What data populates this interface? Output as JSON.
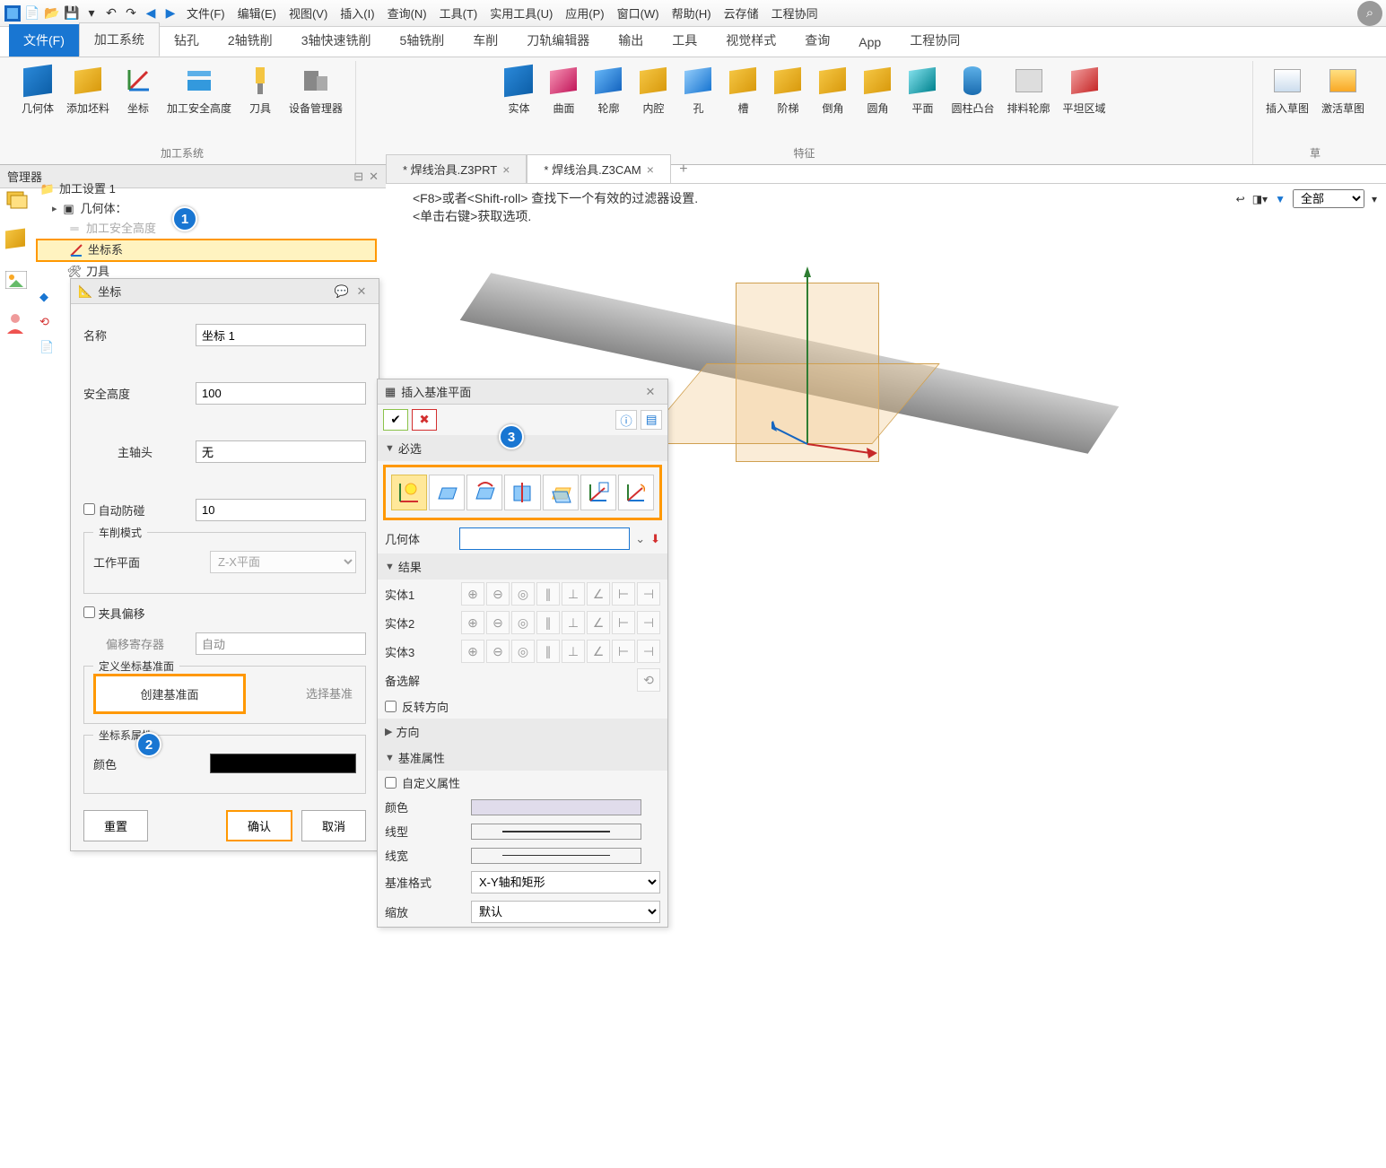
{
  "menu": {
    "file": "文件(F)",
    "edit": "编辑(E)",
    "view": "视图(V)",
    "insert": "插入(I)",
    "query": "查询(N)",
    "tools": "工具(T)",
    "utilities": "实用工具(U)",
    "apps": "应用(P)",
    "window": "窗口(W)",
    "help": "帮助(H)",
    "cloud": "云存储",
    "collab": "工程协同"
  },
  "ribbon_tabs": {
    "file": "文件(F)",
    "cam": "加工系统",
    "drill": "钻孔",
    "mill2": "2轴铣削",
    "mill3": "3轴快速铣削",
    "mill5": "5轴铣削",
    "turn": "车削",
    "toolpath": "刀轨编辑器",
    "output": "输出",
    "tool": "工具",
    "style": "视觉样式",
    "query": "查询",
    "app": "App",
    "collab": "工程协同"
  },
  "ribbon": {
    "group1_title": "加工系统",
    "geom": "几何体",
    "stock": "添加坯料",
    "coord": "坐标",
    "safeh": "加工安全高度",
    "cutter": "刀具",
    "devmgr": "设备管理器",
    "group2_title": "特征",
    "solid": "实体",
    "surface": "曲面",
    "profile": "轮廓",
    "pocket": "内腔",
    "hole": "孔",
    "slot": "槽",
    "step": "阶梯",
    "chamfer": "倒角",
    "fillet": "圆角",
    "plane": "平面",
    "boss": "圆柱凸台",
    "profnc": "排料轮廓",
    "flat": "平坦区域",
    "group3_title": "草",
    "sketch": "插入草图",
    "activate_sketch": "激活草图"
  },
  "manager": {
    "title": "管理器"
  },
  "tree": {
    "root": "加工设置 1",
    "geom": "几何体：",
    "safeh": "加工安全高度",
    "coord": "坐标系",
    "tool": "刀具"
  },
  "tabs": {
    "prt": "* 焊线治具.Z3PRT",
    "cam": "* 焊线治具.Z3CAM"
  },
  "viewport": {
    "hint1": "<F8>或者<Shift-roll> 查找下一个有效的过滤器设置.",
    "hint2": "<单击右键>获取选项.",
    "filter_all": "全部"
  },
  "coord_dialog": {
    "title": "坐标",
    "name_label": "名称",
    "name_value": "坐标 1",
    "safe_label": "安全高度",
    "safe_value": "100",
    "spindle_label": "主轴头",
    "spindle_value": "无",
    "collision_label": "自动防碰",
    "collision_value": "10",
    "turn_legend": "车削模式",
    "work_plane_label": "工作平面",
    "work_plane_value": "Z-X平面",
    "fixture_offset_label": "夹具偏移",
    "offset_reg_label": "偏移寄存器",
    "offset_reg_value": "自动",
    "define_legend": "定义坐标基准面",
    "create_base": "创建基准面",
    "select_base": "选择基准",
    "props_legend": "坐标系属性",
    "color_label": "颜色",
    "reset": "重置",
    "ok": "确认",
    "cancel": "取消"
  },
  "datum_dialog": {
    "title": "插入基准平面",
    "required": "必选",
    "geom_label": "几何体",
    "result": "结果",
    "entity1": "实体1",
    "entity2": "实体2",
    "entity3": "实体3",
    "backup": "备选解",
    "reverse": "反转方向",
    "direction": "方向",
    "props": "基准属性",
    "custom_prop": "自定义属性",
    "color": "颜色",
    "linetype": "线型",
    "lineweight": "线宽",
    "format": "基准格式",
    "format_value": "X-Y轴和矩形",
    "scale": "缩放",
    "scale_value": "默认"
  },
  "callouts": {
    "c1": "1",
    "c2": "2",
    "c3": "3"
  }
}
